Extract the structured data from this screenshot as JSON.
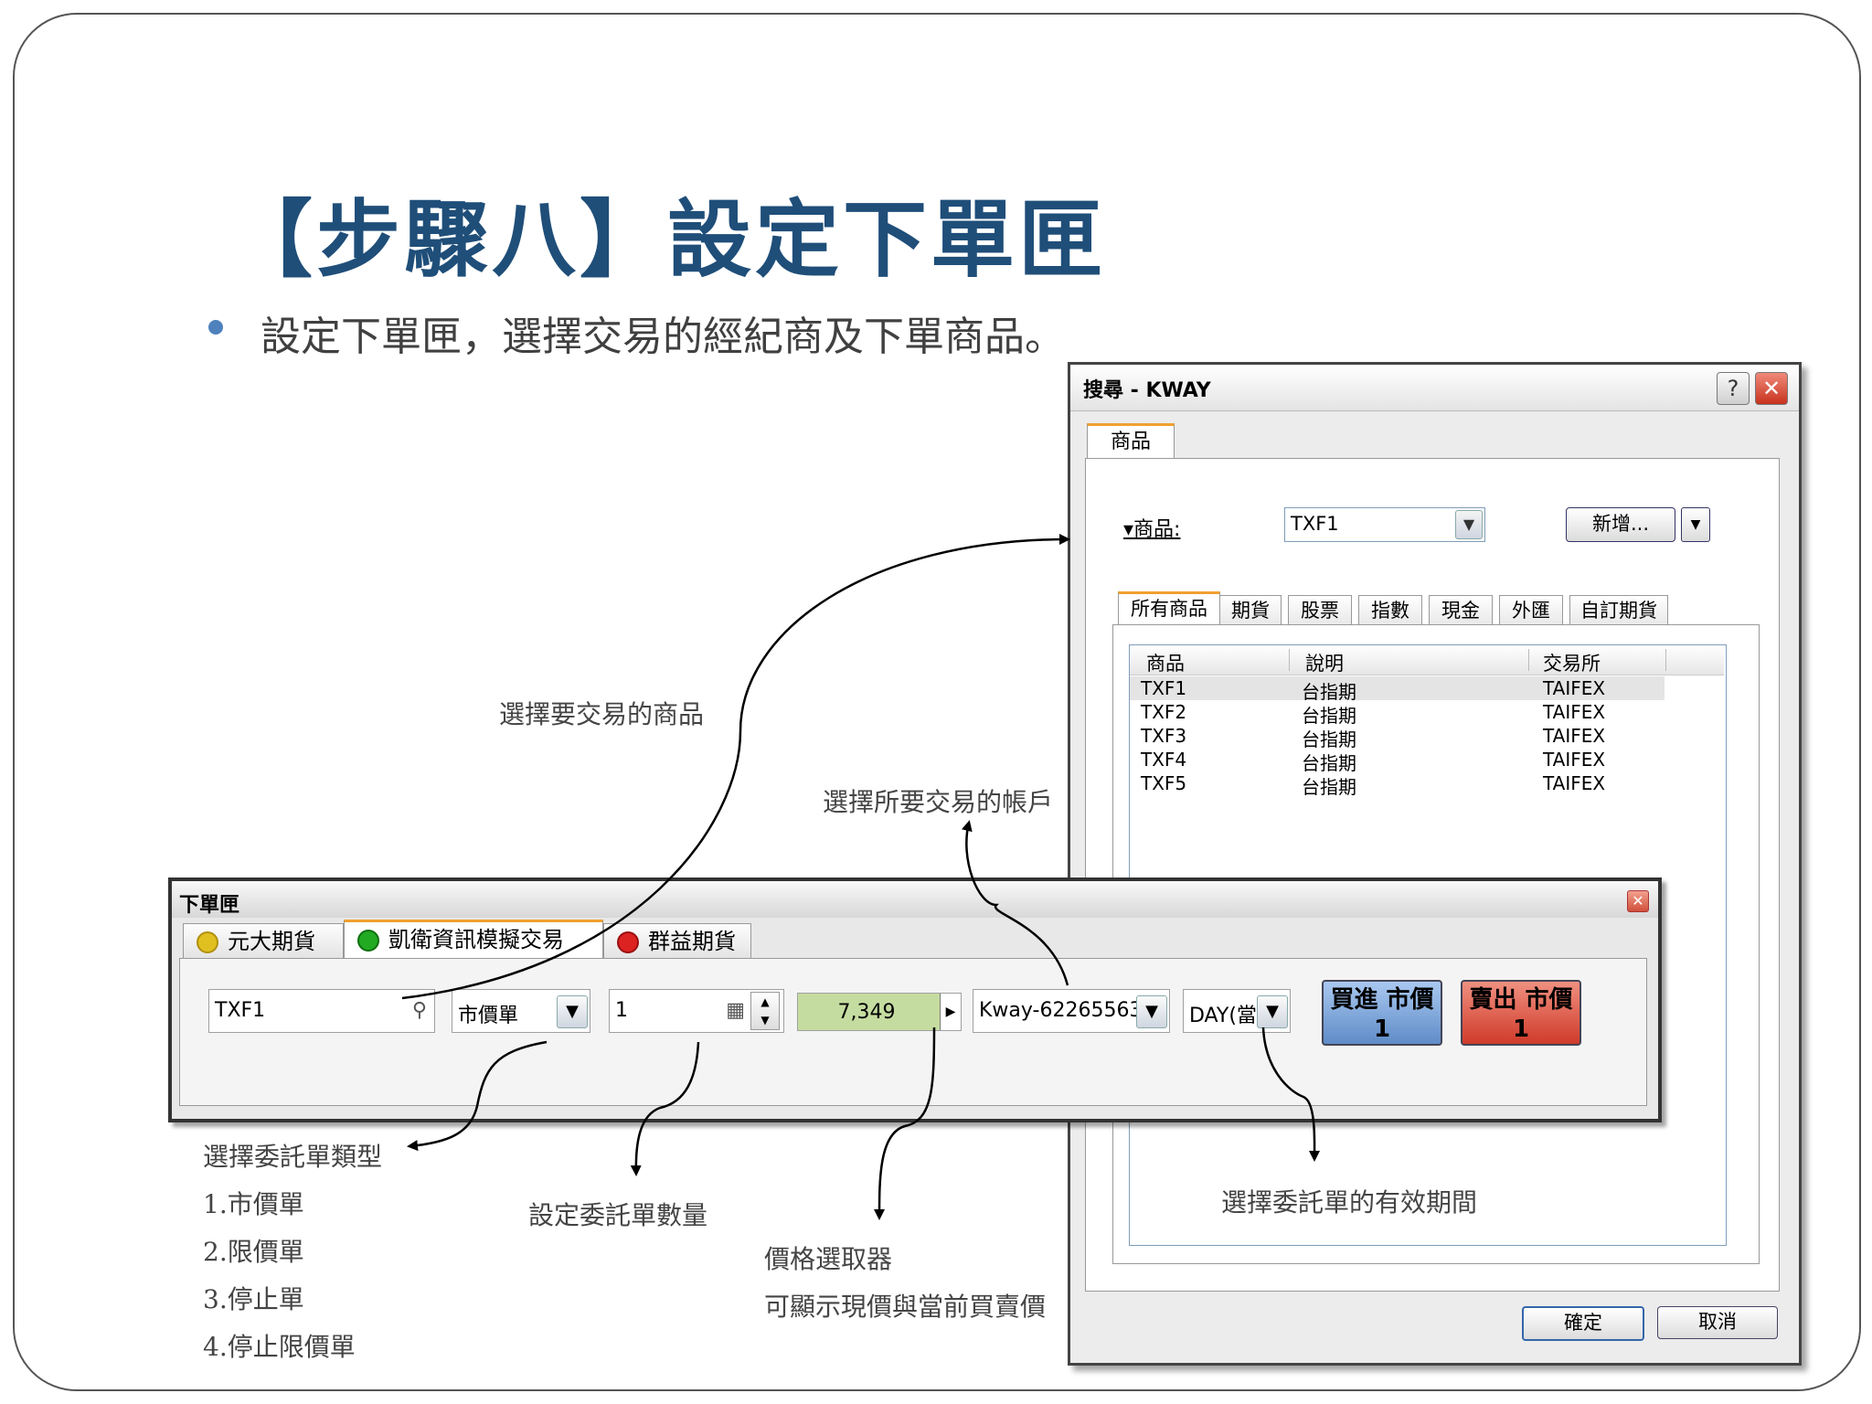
{
  "slide": {
    "title": "【步驟八】設定下單匣",
    "bullet": "設定下單匣，選擇交易的經紀商及下單商品。"
  },
  "annotations": {
    "select_product": "選擇要交易的商品",
    "select_account": "選擇所要交易的帳戶",
    "order_type": "選擇委託單類型",
    "order_type_1": "1.市價單",
    "order_type_2": "2.限價單",
    "order_type_3": "3.停止單",
    "order_type_4": "4.停止限價單",
    "quantity": "設定委託單數量",
    "price_picker": "價格選取器",
    "price_picker_desc": "可顯示現價與當前買賣價",
    "validity": "選擇委託單的有效期間"
  },
  "search_dialog": {
    "title": "搜尋 - KWAY",
    "help_glyph": "?",
    "close_glyph": "✕",
    "tab": "商品",
    "product_label": "商品:",
    "product_value": "TXF1",
    "new_button": "新增...",
    "filter_tabs": [
      "所有商品",
      "期貨",
      "股票",
      "指數",
      "現金",
      "外匯",
      "自訂期貨"
    ],
    "columns": [
      "商品",
      "說明",
      "交易所"
    ],
    "rows": [
      {
        "symbol": "TXF1",
        "desc": "台指期",
        "exchange": "TAIFEX"
      },
      {
        "symbol": "TXF2",
        "desc": "台指期",
        "exchange": "TAIFEX"
      },
      {
        "symbol": "TXF3",
        "desc": "台指期",
        "exchange": "TAIFEX"
      },
      {
        "symbol": "TXF4",
        "desc": "台指期",
        "exchange": "TAIFEX"
      },
      {
        "symbol": "TXF5",
        "desc": "台指期",
        "exchange": "TAIFEX"
      }
    ],
    "ok_button": "確定",
    "cancel_button": "取消"
  },
  "order_box": {
    "title": "下單匣",
    "close_glyph": "✕",
    "broker_tabs": [
      {
        "label": "元大期貨",
        "status_color": "#e0c020"
      },
      {
        "label": "凱衛資訊模擬交易",
        "status_color": "#22aa22"
      },
      {
        "label": "群益期貨",
        "status_color": "#dd2222"
      }
    ],
    "symbol": "TXF1",
    "order_type": "市價單",
    "quantity": "1",
    "price": "7,349",
    "account": "Kway-62265563",
    "validity": "DAY(當",
    "buy_label": "買進 市價",
    "buy_qty": "1",
    "sell_label": "賣出 市價",
    "sell_qty": "1"
  },
  "colors": {
    "title": "#1f4e79",
    "bullet": "#4f81bd",
    "price_field": "#c5dca0",
    "buy": "#7aa4dc",
    "sell": "#e0604e",
    "tab_accent": "#f0a030"
  }
}
